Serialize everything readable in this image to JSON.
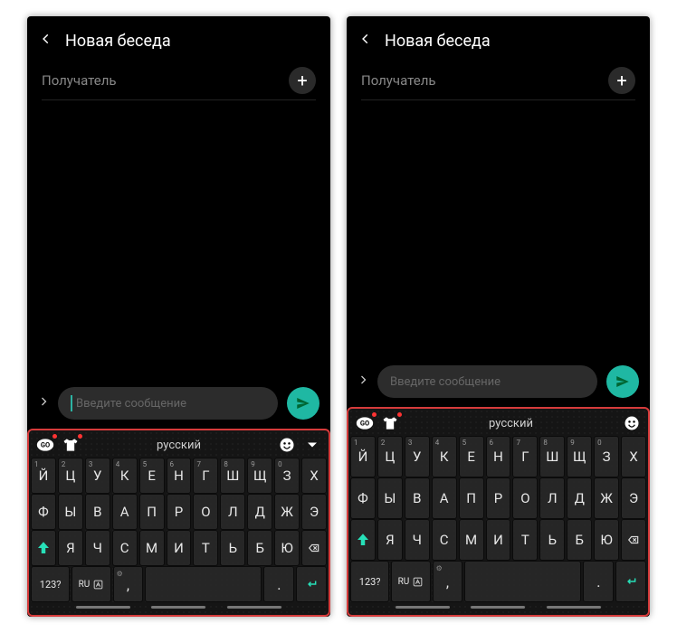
{
  "colors": {
    "accent": "#1fb8a3",
    "highlight_border": "#d63b3b"
  },
  "header": {
    "title": "Новая беседа"
  },
  "recipient": {
    "placeholder": "Получатель"
  },
  "message": {
    "placeholder": "Введите сообщение"
  },
  "keyboard": {
    "language_label": "русский",
    "row1_nums": [
      "1",
      "2",
      "3",
      "4",
      "5",
      "6",
      "7",
      "8",
      "9",
      "0",
      ""
    ],
    "row1": [
      "Й",
      "Ц",
      "У",
      "К",
      "Е",
      "Н",
      "Г",
      "Ш",
      "Щ",
      "З",
      "Х"
    ],
    "row2": [
      "Ф",
      "Ы",
      "В",
      "А",
      "П",
      "Р",
      "О",
      "Л",
      "Д",
      "Ж",
      "Э"
    ],
    "row3": [
      "Я",
      "Ч",
      "С",
      "М",
      "И",
      "Т",
      "Ь",
      "Б",
      "Ю"
    ],
    "sym": "123?",
    "lang_short": "RU",
    "comma": ",",
    "dot": "."
  }
}
